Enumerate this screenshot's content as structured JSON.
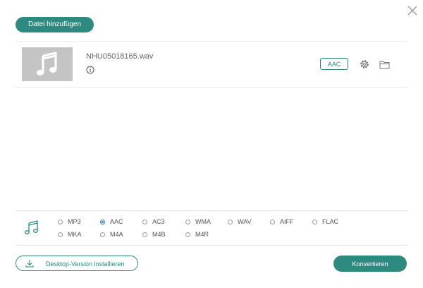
{
  "toolbar": {
    "add_file_label": "Datei hinzufügen"
  },
  "file": {
    "name": "NHU05018165.wav",
    "output_format": "AAC"
  },
  "formats": {
    "selected": "AAC",
    "options": [
      "MP3",
      "AAC",
      "AC3",
      "WMA",
      "WAV",
      "AIFF",
      "FLAC",
      "MKA",
      "M4A",
      "M4B",
      "M4R"
    ]
  },
  "footer": {
    "install_label": "Desktop-Version installieren",
    "convert_label": "Konvertieren"
  },
  "colors": {
    "accent": "#2d8a7f",
    "radio_selected": "#2b79d6"
  },
  "icons": {
    "close": "close-icon",
    "thumbnail": "music-note-icon",
    "info": "info-icon",
    "settings": "gear-icon",
    "folder": "folder-icon",
    "format": "music-note-icon",
    "install": "download-icon"
  }
}
